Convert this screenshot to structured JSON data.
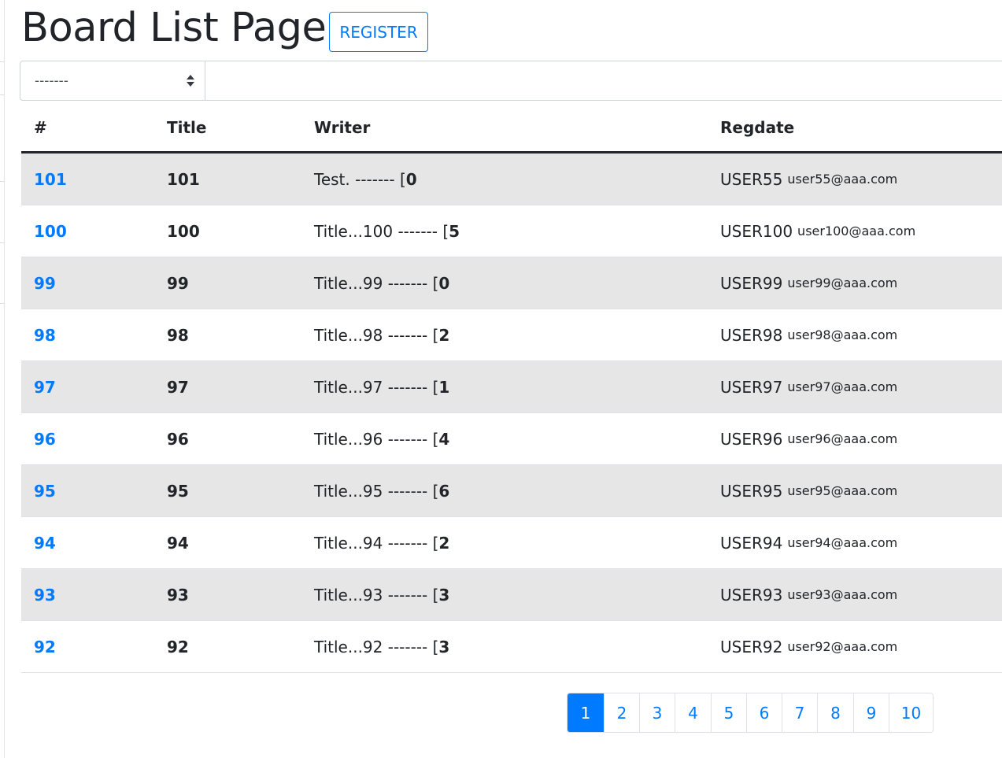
{
  "header": {
    "title": "Board List Page",
    "register_label": "REGISTER"
  },
  "search": {
    "type_value": "-------"
  },
  "table": {
    "columns": [
      "#",
      "Title",
      "Writer",
      "Regdate"
    ],
    "rows": [
      {
        "num": "101",
        "title": "101",
        "writer_text": "Test. ------- [",
        "writer_count": "0",
        "user": "USER55",
        "email": "user55@aaa.com"
      },
      {
        "num": "100",
        "title": "100",
        "writer_text": "Title...100 ------- [",
        "writer_count": "5",
        "user": "USER100",
        "email": "user100@aaa.com"
      },
      {
        "num": "99",
        "title": "99",
        "writer_text": "Title...99 ------- [",
        "writer_count": "0",
        "user": "USER99",
        "email": "user99@aaa.com"
      },
      {
        "num": "98",
        "title": "98",
        "writer_text": "Title...98 ------- [",
        "writer_count": "2",
        "user": "USER98",
        "email": "user98@aaa.com"
      },
      {
        "num": "97",
        "title": "97",
        "writer_text": "Title...97 ------- [",
        "writer_count": "1",
        "user": "USER97",
        "email": "user97@aaa.com"
      },
      {
        "num": "96",
        "title": "96",
        "writer_text": "Title...96 ------- [",
        "writer_count": "4",
        "user": "USER96",
        "email": "user96@aaa.com"
      },
      {
        "num": "95",
        "title": "95",
        "writer_text": "Title...95 ------- [",
        "writer_count": "6",
        "user": "USER95",
        "email": "user95@aaa.com"
      },
      {
        "num": "94",
        "title": "94",
        "writer_text": "Title...94 ------- [",
        "writer_count": "2",
        "user": "USER94",
        "email": "user94@aaa.com"
      },
      {
        "num": "93",
        "title": "93",
        "writer_text": "Title...93 ------- [",
        "writer_count": "3",
        "user": "USER93",
        "email": "user93@aaa.com"
      },
      {
        "num": "92",
        "title": "92",
        "writer_text": "Title...92 ------- [",
        "writer_count": "3",
        "user": "USER92",
        "email": "user92@aaa.com"
      }
    ]
  },
  "pagination": {
    "pages": [
      "1",
      "2",
      "3",
      "4",
      "5",
      "6",
      "7",
      "8",
      "9",
      "10"
    ],
    "active": "1"
  },
  "colors": {
    "primary": "#007bff",
    "stripe": "#e6e6e6",
    "text": "#212529"
  }
}
